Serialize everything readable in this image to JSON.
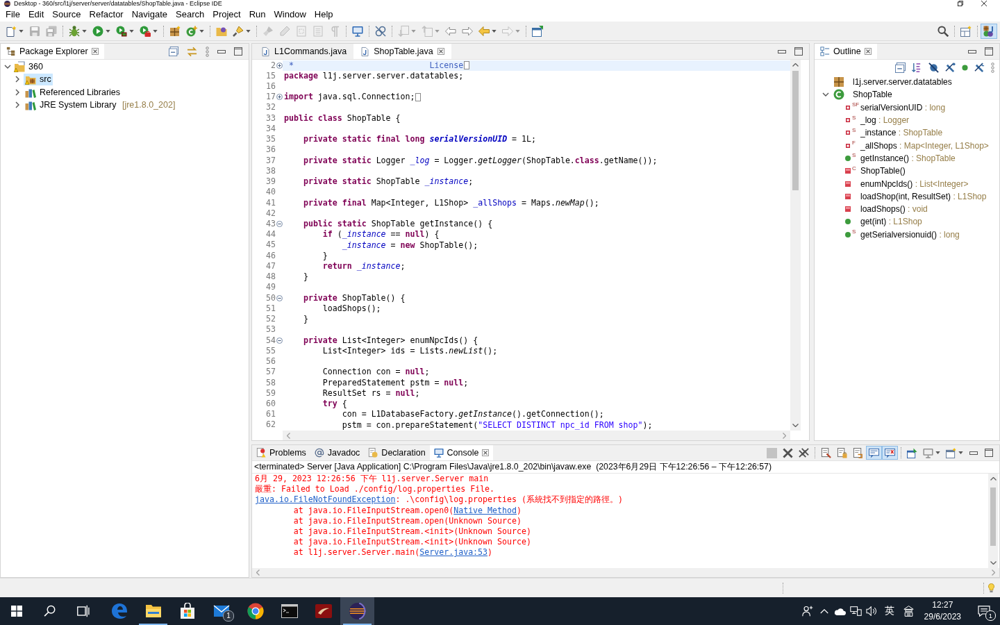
{
  "window": {
    "title": "Desktop - 360/src/l1j/server/server/datatables/ShopTable.java - Eclipse IDE"
  },
  "menu": [
    "File",
    "Edit",
    "Source",
    "Refactor",
    "Navigate",
    "Search",
    "Project",
    "Run",
    "Window",
    "Help"
  ],
  "toolbar": {
    "left": [
      {
        "kind": "new",
        "dropdown": true,
        "disabled": false
      },
      {
        "kind": "save",
        "dropdown": false,
        "disabled": true
      },
      {
        "kind": "save-all",
        "dropdown": false,
        "disabled": true
      },
      {
        "kind": "separator"
      },
      {
        "kind": "debug",
        "dropdown": true,
        "disabled": false
      },
      {
        "kind": "run",
        "dropdown": true,
        "disabled": false
      },
      {
        "kind": "coverage",
        "dropdown": true,
        "disabled": false
      },
      {
        "kind": "external-tools",
        "dropdown": true,
        "disabled": false
      },
      {
        "kind": "separator"
      },
      {
        "kind": "new-package",
        "dropdown": false,
        "disabled": false
      },
      {
        "kind": "new-class",
        "dropdown": true,
        "disabled": false
      },
      {
        "kind": "separator"
      },
      {
        "kind": "open-type",
        "dropdown": false,
        "disabled": false
      },
      {
        "kind": "search",
        "dropdown": true,
        "disabled": false
      },
      {
        "kind": "separator"
      },
      {
        "kind": "mark-occurrences",
        "dropdown": false,
        "disabled": true
      },
      {
        "kind": "highlight",
        "dropdown": false,
        "disabled": true
      },
      {
        "kind": "block-selection",
        "dropdown": false,
        "disabled": true
      },
      {
        "kind": "breadcrumb",
        "dropdown": false,
        "disabled": true
      },
      {
        "kind": "whitespace",
        "dropdown": false,
        "disabled": true
      },
      {
        "kind": "separator"
      },
      {
        "kind": "console",
        "dropdown": false,
        "disabled": false
      },
      {
        "kind": "separator"
      },
      {
        "kind": "link",
        "dropdown": false,
        "disabled": false
      },
      {
        "kind": "separator"
      },
      {
        "kind": "next-annotation",
        "dropdown": true,
        "disabled": true
      },
      {
        "kind": "previous-annotation",
        "dropdown": true,
        "disabled": true
      },
      {
        "kind": "last-edit",
        "dropdown": false,
        "disabled": false
      },
      {
        "kind": "next-edit",
        "dropdown": false,
        "disabled": false
      },
      {
        "kind": "back",
        "dropdown": true,
        "disabled": false
      },
      {
        "kind": "forward",
        "dropdown": true,
        "disabled": true
      },
      {
        "kind": "separator"
      },
      {
        "kind": "pin",
        "dropdown": false,
        "disabled": false
      }
    ],
    "right": [
      {
        "kind": "search-global",
        "on": false
      },
      {
        "kind": "separator"
      },
      {
        "kind": "open-perspective",
        "on": false
      },
      {
        "kind": "separator"
      },
      {
        "kind": "java-perspective",
        "on": true
      }
    ]
  },
  "package_explorer": {
    "title": "Package Explorer",
    "tree": [
      {
        "label": "360",
        "kind": "project",
        "expanded": true,
        "selected": false,
        "children": [
          {
            "label": "src",
            "kind": "source-folder",
            "expanded": false,
            "selected": true
          },
          {
            "label": "Referenced Libraries",
            "kind": "libraries",
            "expanded": false,
            "selected": false
          },
          {
            "label": "JRE System Library",
            "decoration": "[jre1.8.0_202]",
            "kind": "libraries",
            "expanded": false,
            "selected": false
          }
        ]
      }
    ]
  },
  "editor": {
    "tabs": [
      {
        "label": "L1Commands.java",
        "selected": false
      },
      {
        "label": "ShopTable.java",
        "selected": true
      }
    ],
    "lines": [
      {
        "number": "2",
        "expanded": false,
        "current": true,
        "tokens": [
          {
            "text": " *                            License",
            "kind": "comment"
          }
        ]
      },
      {
        "number": "15",
        "current": false,
        "tokens": [
          {
            "text": "package",
            "kind": "keyword"
          },
          {
            "text": " l1j.server.server.datatables;",
            "kind": "text"
          }
        ]
      },
      {
        "number": "16",
        "current": false
      },
      {
        "number": "17",
        "expanded": false,
        "current": false,
        "tokens": [
          {
            "text": "import",
            "kind": "keyword"
          },
          {
            "text": " java.sql.Connection;",
            "kind": "text"
          }
        ]
      },
      {
        "number": "32",
        "current": false
      },
      {
        "number": "33",
        "current": false,
        "tokens": [
          {
            "text": "public",
            "kind": "keyword"
          },
          {
            "text": " class",
            "kind": "keyword"
          },
          {
            "text": " ShopTable {",
            "kind": "text"
          }
        ]
      },
      {
        "number": "34",
        "current": false
      },
      {
        "number": "35",
        "current": false,
        "tokens": [
          {
            "text": "    private",
            "kind": "keyword"
          },
          {
            "text": " static",
            "kind": "keyword"
          },
          {
            "text": " final",
            "kind": "keyword"
          },
          {
            "text": " long",
            "kind": "keyword"
          },
          {
            "text": " serialVersionUID",
            "kind": "constant"
          },
          {
            "text": " = 1L;",
            "kind": "text"
          }
        ]
      },
      {
        "number": "36",
        "current": false
      },
      {
        "number": "37",
        "current": false,
        "tokens": [
          {
            "text": "    private",
            "kind": "keyword"
          },
          {
            "text": " static",
            "kind": "keyword"
          },
          {
            "text": " Logger ",
            "kind": "text"
          },
          {
            "text": "_log",
            "kind": "static-field"
          },
          {
            "text": " = Logger.",
            "kind": "text"
          },
          {
            "text": "getLogger",
            "kind": "static-method"
          },
          {
            "text": "(ShopTable.",
            "kind": "text"
          },
          {
            "text": "class",
            "kind": "keyword"
          },
          {
            "text": ".getName());",
            "kind": "text"
          }
        ]
      },
      {
        "number": "38",
        "current": false
      },
      {
        "number": "39",
        "current": false,
        "tokens": [
          {
            "text": "    private",
            "kind": "keyword"
          },
          {
            "text": " static",
            "kind": "keyword"
          },
          {
            "text": " ShopTable ",
            "kind": "text"
          },
          {
            "text": "_instance",
            "kind": "static-field"
          },
          {
            "text": ";",
            "kind": "text"
          }
        ]
      },
      {
        "number": "40",
        "current": false
      },
      {
        "number": "41",
        "current": false,
        "tokens": [
          {
            "text": "    private",
            "kind": "keyword"
          },
          {
            "text": " final",
            "kind": "keyword"
          },
          {
            "text": " Map<Integer, L1Shop> ",
            "kind": "text"
          },
          {
            "text": "_allShops",
            "kind": "field"
          },
          {
            "text": " = Maps.",
            "kind": "text"
          },
          {
            "text": "newMap",
            "kind": "static-method"
          },
          {
            "text": "();",
            "kind": "text"
          }
        ]
      },
      {
        "number": "42",
        "current": false
      },
      {
        "number": "43",
        "expanded": true,
        "current": false,
        "tokens": [
          {
            "text": "    public",
            "kind": "keyword"
          },
          {
            "text": " static",
            "kind": "keyword"
          },
          {
            "text": " ShopTable getInstance() {",
            "kind": "text"
          }
        ]
      },
      {
        "number": "44",
        "current": false,
        "tokens": [
          {
            "text": "        if",
            "kind": "keyword"
          },
          {
            "text": " (",
            "kind": "text"
          },
          {
            "text": "_instance",
            "kind": "static-field"
          },
          {
            "text": " == ",
            "kind": "text"
          },
          {
            "text": "null",
            "kind": "keyword"
          },
          {
            "text": ") {",
            "kind": "text"
          }
        ]
      },
      {
        "number": "45",
        "current": false,
        "tokens": [
          {
            "text": "            _instance",
            "kind": "static-field"
          },
          {
            "text": " = ",
            "kind": "text"
          },
          {
            "text": "new",
            "kind": "keyword"
          },
          {
            "text": " ShopTable();",
            "kind": "text"
          }
        ]
      },
      {
        "number": "46",
        "current": false,
        "tokens": [
          {
            "text": "        }",
            "kind": "text"
          }
        ]
      },
      {
        "number": "47",
        "current": false,
        "tokens": [
          {
            "text": "        return",
            "kind": "keyword"
          },
          {
            "text": " _instance",
            "kind": "static-field"
          },
          {
            "text": ";",
            "kind": "text"
          }
        ]
      },
      {
        "number": "48",
        "current": false,
        "tokens": [
          {
            "text": "    }",
            "kind": "text"
          }
        ]
      },
      {
        "number": "49",
        "current": false
      },
      {
        "number": "50",
        "expanded": true,
        "current": false,
        "tokens": [
          {
            "text": "    private",
            "kind": "keyword"
          },
          {
            "text": " ShopTable() {",
            "kind": "text"
          }
        ]
      },
      {
        "number": "51",
        "current": false,
        "tokens": [
          {
            "text": "        loadShops();",
            "kind": "text"
          }
        ]
      },
      {
        "number": "52",
        "current": false,
        "tokens": [
          {
            "text": "    }",
            "kind": "text"
          }
        ]
      },
      {
        "number": "53",
        "current": false
      },
      {
        "number": "54",
        "expanded": true,
        "current": false,
        "tokens": [
          {
            "text": "    private",
            "kind": "keyword"
          },
          {
            "text": " List<Integer> enumNpcIds() {",
            "kind": "text"
          }
        ]
      },
      {
        "number": "55",
        "current": false,
        "tokens": [
          {
            "text": "        List<Integer> ids = Lists.",
            "kind": "text"
          },
          {
            "text": "newList",
            "kind": "static-method"
          },
          {
            "text": "();",
            "kind": "text"
          }
        ]
      },
      {
        "number": "56",
        "current": false
      },
      {
        "number": "57",
        "current": false,
        "tokens": [
          {
            "text": "        Connection con = ",
            "kind": "text"
          },
          {
            "text": "null",
            "kind": "keyword"
          },
          {
            "text": ";",
            "kind": "text"
          }
        ]
      },
      {
        "number": "58",
        "current": false,
        "tokens": [
          {
            "text": "        PreparedStatement pstm = ",
            "kind": "text"
          },
          {
            "text": "null",
            "kind": "keyword"
          },
          {
            "text": ";",
            "kind": "text"
          }
        ]
      },
      {
        "number": "59",
        "current": false,
        "tokens": [
          {
            "text": "        ResultSet rs = ",
            "kind": "text"
          },
          {
            "text": "null",
            "kind": "keyword"
          },
          {
            "text": ";",
            "kind": "text"
          }
        ]
      },
      {
        "number": "60",
        "current": false,
        "tokens": [
          {
            "text": "        try",
            "kind": "keyword"
          },
          {
            "text": " {",
            "kind": "text"
          }
        ]
      },
      {
        "number": "61",
        "current": false,
        "tokens": [
          {
            "text": "            con = L1DatabaseFactory.",
            "kind": "text"
          },
          {
            "text": "getInstance",
            "kind": "static-method"
          },
          {
            "text": "().getConnection();",
            "kind": "text"
          }
        ]
      },
      {
        "number": "62",
        "current": false,
        "tokens": [
          {
            "text": "            pstm = con.prepareStatement(",
            "kind": "text"
          },
          {
            "text": "\"SELECT DISTINCT npc_id FROM shop\"",
            "kind": "string"
          },
          {
            "text": ");",
            "kind": "text"
          }
        ]
      }
    ]
  },
  "outline": {
    "title": "Outline",
    "tree": [
      {
        "label": "l1j.server.server.datatables",
        "kind": "package",
        "selected": false
      },
      {
        "label": "ShopTable",
        "kind": "class",
        "expanded": true,
        "selected": false,
        "children": [
          {
            "label": "serialVersionUID",
            "detail": ": long",
            "kind": "private-field",
            "flags": "SF",
            "selected": false
          },
          {
            "label": "_log",
            "detail": ": Logger",
            "kind": "private-field",
            "flags": "S",
            "selected": false
          },
          {
            "label": "_instance",
            "detail": ": ShopTable",
            "kind": "private-field",
            "flags": "S",
            "selected": false
          },
          {
            "label": "_allShops",
            "detail": ": Map<Integer, L1Shop>",
            "kind": "private-field",
            "flags": "F",
            "selected": false
          },
          {
            "label": "getInstance()",
            "detail": ": ShopTable",
            "kind": "public-method",
            "flags": "S",
            "selected": false
          },
          {
            "label": "ShopTable()",
            "kind": "private-method",
            "flags": "C",
            "selected": false
          },
          {
            "label": "enumNpcIds()",
            "detail": ": List<Integer>",
            "kind": "private-method",
            "selected": false
          },
          {
            "label": "loadShop(int, ResultSet)",
            "detail": ": L1Shop",
            "kind": "private-method",
            "selected": false
          },
          {
            "label": "loadShops()",
            "detail": ": void",
            "kind": "private-method",
            "selected": false
          },
          {
            "label": "get(int)",
            "detail": ": L1Shop",
            "kind": "public-method",
            "selected": false
          },
          {
            "label": "getSerialversionuid()",
            "detail": ": long",
            "kind": "public-method",
            "flags": "S",
            "selected": false
          }
        ]
      }
    ]
  },
  "console": {
    "tabs": [
      {
        "label": "Problems",
        "kind": "problems",
        "selected": false
      },
      {
        "label": "Javadoc",
        "kind": "javadoc",
        "selected": false
      },
      {
        "label": "Declaration",
        "kind": "declaration",
        "selected": false
      },
      {
        "label": "Console",
        "kind": "console",
        "selected": true
      }
    ],
    "toolbar": [
      {
        "kind": "terminate",
        "dropdown": false,
        "disabled": true,
        "on": false
      },
      {
        "kind": "remove-launch",
        "dropdown": false,
        "disabled": false,
        "on": false
      },
      {
        "kind": "remove-all",
        "dropdown": false,
        "disabled": false,
        "on": false
      },
      {
        "kind": "separator"
      },
      {
        "kind": "clear",
        "dropdown": false,
        "disabled": false,
        "on": false
      },
      {
        "kind": "scroll-lock",
        "dropdown": false,
        "disabled": false,
        "on": false
      },
      {
        "kind": "word-wrap",
        "dropdown": false,
        "disabled": false,
        "on": false
      },
      {
        "kind": "show-stdout",
        "dropdown": false,
        "disabled": false,
        "on": true
      },
      {
        "kind": "show-stderr",
        "dropdown": false,
        "disabled": false,
        "on": true
      },
      {
        "kind": "separator"
      },
      {
        "kind": "pin-console",
        "dropdown": false,
        "disabled": false,
        "on": false
      },
      {
        "kind": "display-console",
        "dropdown": true,
        "disabled": false,
        "on": false
      },
      {
        "kind": "open-console",
        "dropdown": true,
        "disabled": false,
        "on": false
      }
    ],
    "process": "<terminated> Server [Java Application] C:\\Program Files\\Java\\jre1.8.0_202\\bin\\javaw.exe  (2023年6月29日 下午12:26:56 – 下午12:26:57)",
    "lines": [
      {
        "segments": [
          {
            "text": "6月 29, 2023 12:26:56 下午 l1j.server.Server main",
            "kind": "text"
          }
        ]
      },
      {
        "segments": [
          {
            "text": "嚴重: Failed to Load ./config/log.properties File.",
            "kind": "text"
          }
        ]
      },
      {
        "segments": [
          {
            "text": "java.io.FileNotFoundException",
            "kind": "link"
          },
          {
            "text": ": .\\config\\log.properties (系統找不到指定的路徑。)",
            "kind": "text"
          }
        ]
      },
      {
        "segments": [
          {
            "text": "\tat java.io.FileInputStream.open0(",
            "kind": "text"
          },
          {
            "text": "Native Method",
            "kind": "link"
          },
          {
            "text": ")",
            "kind": "text"
          }
        ]
      },
      {
        "segments": [
          {
            "text": "\tat java.io.FileInputStream.open(Unknown Source)",
            "kind": "text"
          }
        ]
      },
      {
        "segments": [
          {
            "text": "\tat java.io.FileInputStream.<init>(Unknown Source)",
            "kind": "text"
          }
        ]
      },
      {
        "segments": [
          {
            "text": "\tat java.io.FileInputStream.<init>(Unknown Source)",
            "kind": "text"
          }
        ]
      },
      {
        "segments": [
          {
            "text": "\tat l1j.server.Server.main(",
            "kind": "text"
          },
          {
            "text": "Server.java:53",
            "kind": "link"
          },
          {
            "text": ")",
            "kind": "text"
          }
        ]
      }
    ]
  },
  "taskbar": {
    "apps": [
      {
        "kind": "edge",
        "running": false,
        "selected": false
      },
      {
        "kind": "file-explorer",
        "running": true,
        "selected": false
      },
      {
        "kind": "store",
        "running": false,
        "selected": false
      },
      {
        "kind": "mail",
        "running": false,
        "selected": false,
        "badge": "1"
      },
      {
        "kind": "chrome",
        "running": false,
        "selected": false
      },
      {
        "kind": "terminal",
        "running": false,
        "selected": false
      },
      {
        "kind": "game",
        "running": false,
        "selected": false
      },
      {
        "kind": "eclipse",
        "running": true,
        "selected": true
      }
    ],
    "input_language": "英",
    "time": "12:27",
    "date": "29/6/2023",
    "notification_badge": "1"
  }
}
